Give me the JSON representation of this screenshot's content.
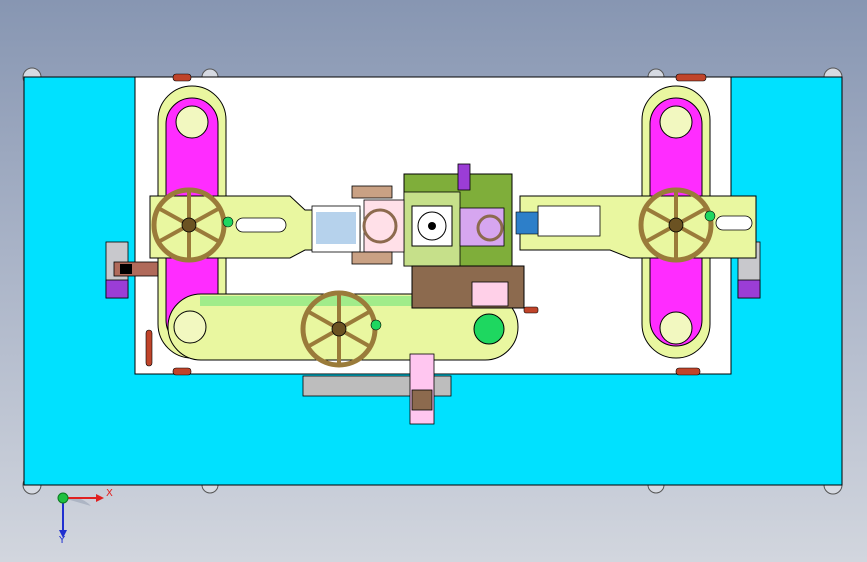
{
  "viewport": {
    "background_top": "#8796b2",
    "background_bottom": "#d2d6de"
  },
  "colors": {
    "base_plate": "#00e1ff",
    "sub_plate": "#ffffff",
    "outline": "#000000",
    "arm": "#e9f7a0",
    "arm_edge": "#b8c95a",
    "slide_magenta": "#ff2cff",
    "handwheel": "#9a7b3a",
    "block_olive": "#7fae3a",
    "block_brown": "#8c6a4e",
    "block_lavender": "#d6a6f0",
    "green_button": "#1ed760",
    "lever_red": "#c0442a"
  },
  "icons": {
    "triad": "coordinate-triad-icon",
    "handwheel": "handwheel-icon"
  },
  "triad": {
    "x_label": "X",
    "y_label": "Y"
  }
}
